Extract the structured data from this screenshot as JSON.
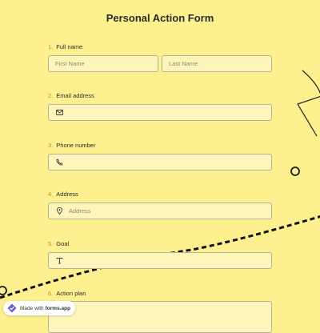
{
  "form": {
    "title": "Personal Action Form"
  },
  "questions": [
    {
      "number": "1.",
      "label": "Full name",
      "first_placeholder": "First Name",
      "last_placeholder": "Last Name"
    },
    {
      "number": "2.",
      "label": "Email address",
      "icon": "mail-icon"
    },
    {
      "number": "3.",
      "label": "Phone number",
      "icon": "phone-icon"
    },
    {
      "number": "4.",
      "label": "Address",
      "icon": "location-pin-icon",
      "placeholder": "Address"
    },
    {
      "number": "5.",
      "label": "Goal",
      "icon": "text-icon"
    },
    {
      "number": "6.",
      "label": "Action plan"
    }
  ],
  "badge": {
    "prefix": "Made with",
    "brand": "forms.app",
    "icon": "forms-app-logo-icon"
  },
  "colors": {
    "background": "#fdf08f",
    "field_background": "#fdf5ba",
    "field_border": "#b9b29a",
    "number_accent": "#d28a2a",
    "brand_logo": "#6b5bd2"
  }
}
